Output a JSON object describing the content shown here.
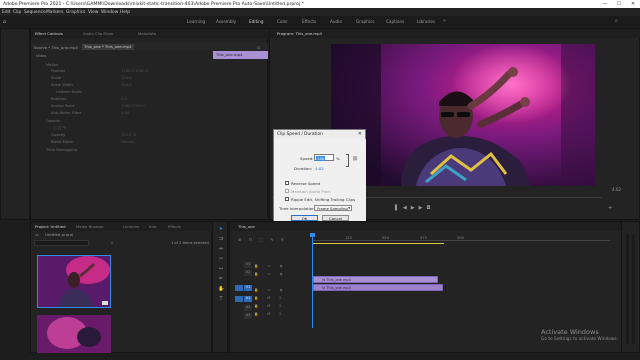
{
  "window": {
    "title": "Adobe Premiere Pro 2021 - C:\\Users\\GAMMI\\Downloads\\mixkit-static-transition-403\\Adobe Premiere Pro Auto-Save\\Untitled.prproj *",
    "minimize": "—",
    "maximize": "☐",
    "close": "✕"
  },
  "menu": [
    "Edit",
    "Clip",
    "Sequence",
    "Markers",
    "Graphics",
    "View",
    "Window",
    "Help"
  ],
  "workspaces": [
    "Learning",
    "Assembly",
    "Editing",
    "Color",
    "Effects",
    "Audio",
    "Graphics",
    "Captions",
    "Libraries"
  ],
  "effect_controls": {
    "tabs": [
      "Effect Controls",
      "Audio Clip Mixer",
      "Metadata"
    ],
    "source_header": "Source * This_one.mp4",
    "clip_header": "This_one * This_one.mp4",
    "clip_badge": "This_one.mp4",
    "video_label": "Video",
    "rows": [
      "Motion",
      "Position",
      "Scale",
      "Scale Width",
      "Uniform Scale",
      "Rotation",
      "Anchor Point",
      "Anti-flicker Filter",
      "Opacity",
      "Opacity",
      "Blend Mode",
      "Time Remapping"
    ],
    "values": [
      "1280.0  1080.0",
      "100.0",
      "100.0",
      "0.0",
      "1280.0  540.0",
      "0.00",
      "100.0 %",
      "Normal"
    ]
  },
  "program": {
    "tab": "Program: This_one.mp4",
    "scrub_value": "4.02"
  },
  "dialog": {
    "title": "Clip Speed / Duration",
    "close": "✕",
    "speed_label": "Speed:",
    "speed_value": "100",
    "speed_unit": "%",
    "duration_label": "Duration:",
    "duration_value": "4:02",
    "reverse_speed": "Reverse Speed",
    "maintain_audio_pitch": "Maintain Audio Pitch",
    "ripple_edit": "Ripple Edit, Shifting Trailing Clips",
    "time_interp_label": "Time Interpolation:",
    "time_interp_value": "Frame Sampling",
    "ok": "OK",
    "cancel": "Cancel"
  },
  "project": {
    "tabs": [
      "Project: Untitled",
      "Media Browser",
      "Libraries",
      "Info",
      "Effects"
    ],
    "name": "Untitled.prproj",
    "items_selected": "1 of 2 items selected"
  },
  "timeline": {
    "tab": "This_one",
    "ruler": [
      "125",
      "250",
      "375",
      "500"
    ],
    "tracks_video": [
      "V3",
      "V2",
      "V1"
    ],
    "tracks_audio": [
      "A1",
      "A2",
      "A3"
    ],
    "clip_v1": "fx  This_one.mp4",
    "clip_a1": "fx  This_one.mp4"
  },
  "windows_watermark": {
    "line1": "Activate Windows",
    "line2": "Go to Settings to activate Windows."
  },
  "colors": {
    "accent": "#2d8ceb",
    "clip_video": "#a98fd4",
    "clip_audio": "#9a83cc",
    "panel": "#232323"
  }
}
